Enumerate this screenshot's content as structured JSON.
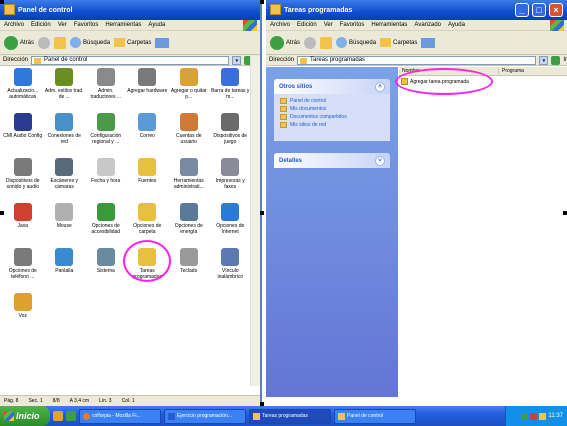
{
  "left_window": {
    "title": "Panel de control",
    "menu": [
      "Archivo",
      "Edición",
      "Ver",
      "Favoritos",
      "Herramientas",
      "Ayuda"
    ],
    "toolbar": {
      "back": "Atrás",
      "search": "Búsqueda",
      "folders": "Carpetas"
    },
    "address": {
      "label": "Dirección",
      "value": "Panel de control",
      "go": "Ir"
    },
    "items": [
      {
        "label": "Actualizacio... automáticas",
        "icon": "windows-update-icon",
        "color": "#2e7ad8"
      },
      {
        "label": "Adm. estilos trad. de ...",
        "icon": "admin-styles-icon",
        "color": "#6b8e23"
      },
      {
        "label": "Admin. traductores ...",
        "icon": "translator-admin-icon",
        "color": "#8a8a8a"
      },
      {
        "label": "Agregar hardware",
        "icon": "add-hardware-icon",
        "color": "#7a7a7a"
      },
      {
        "label": "Agregar o quitar p...",
        "icon": "add-remove-programs-icon",
        "color": "#d9a13b"
      },
      {
        "label": "Barra de tareas y m...",
        "icon": "taskbar-start-icon",
        "color": "#3a6fd8"
      },
      {
        "label": "CMI Audio Config",
        "icon": "audio-config-icon",
        "color": "#2a3c8f"
      },
      {
        "label": "Conexiones de red",
        "icon": "network-connections-icon",
        "color": "#4a90c8"
      },
      {
        "label": "Configuración regional y ...",
        "icon": "regional-settings-icon",
        "color": "#4a9a4a"
      },
      {
        "label": "Correo",
        "icon": "mail-icon",
        "color": "#5a9ad6"
      },
      {
        "label": "Cuentas de usuario",
        "icon": "user-accounts-icon",
        "color": "#d07a3a"
      },
      {
        "label": "Dispositivos de juego",
        "icon": "game-controllers-icon",
        "color": "#6a6a6a"
      },
      {
        "label": "Dispositivos de sonido y audio",
        "icon": "sound-devices-icon",
        "color": "#7a7a7a"
      },
      {
        "label": "Escáneres y cámaras",
        "icon": "scanners-cameras-icon",
        "color": "#5a6a7a"
      },
      {
        "label": "Fecha y hora",
        "icon": "date-time-icon",
        "color": "#c8c8c8"
      },
      {
        "label": "Fuentes",
        "icon": "fonts-icon",
        "color": "#e8c040"
      },
      {
        "label": "Herramientas administrati...",
        "icon": "admin-tools-icon",
        "color": "#7a8aa0"
      },
      {
        "label": "Impresoras y faxes",
        "icon": "printers-faxes-icon",
        "color": "#8a8a9a"
      },
      {
        "label": "Java",
        "icon": "java-icon",
        "color": "#d04030"
      },
      {
        "label": "Mouse",
        "icon": "mouse-icon",
        "color": "#b0b0b0"
      },
      {
        "label": "Opciones de accesibilidad",
        "icon": "accessibility-icon",
        "color": "#3a9a3a"
      },
      {
        "label": "Opciones de carpeta",
        "icon": "folder-options-icon",
        "color": "#e8c040"
      },
      {
        "label": "Opciones de energía",
        "icon": "power-options-icon",
        "color": "#5a7a9a"
      },
      {
        "label": "Opciones de Internet",
        "icon": "internet-options-icon",
        "color": "#2a7ad8"
      },
      {
        "label": "Opciones de teléfono ...",
        "icon": "phone-options-icon",
        "color": "#7a7a7a"
      },
      {
        "label": "Pantalla",
        "icon": "display-icon",
        "color": "#3a8ad0"
      },
      {
        "label": "Sistema",
        "icon": "system-icon",
        "color": "#6a8aa0"
      },
      {
        "label": "Tareas programadas",
        "icon": "scheduled-tasks-icon",
        "color": "#e8c040"
      },
      {
        "label": "Teclado",
        "icon": "keyboard-icon",
        "color": "#9a9a9a"
      },
      {
        "label": "Vínculo inalámbrico",
        "icon": "wireless-link-icon",
        "color": "#5a7ab0"
      },
      {
        "label": "Voz",
        "icon": "speech-icon",
        "color": "#e0a030"
      }
    ],
    "status": [
      "Pág. 8",
      "Sec. 1",
      "8/8",
      "A 3,4 cm",
      "Lín. 3",
      "Col. 1"
    ]
  },
  "right_window": {
    "title": "Tareas programadas",
    "menu": [
      "Archivo",
      "Edición",
      "Ver",
      "Favoritos",
      "Herramientas",
      "Avanzado",
      "Ayuda"
    ],
    "toolbar": {
      "back": "Atrás",
      "search": "Búsqueda",
      "folders": "Carpetas"
    },
    "address": {
      "label": "Dirección",
      "value": "Tareas programadas",
      "go": "Ir"
    },
    "other_sites": {
      "title": "Otros sitios",
      "links": [
        "Panel de control",
        "Mis documentos",
        "Documentos compartidos",
        "Mis sitios de red"
      ]
    },
    "details": {
      "title": "Detalles"
    },
    "columns": [
      "Nombre",
      "Programa"
    ],
    "files": [
      {
        "name": "Agregar tarea programada"
      }
    ]
  },
  "taskbar": {
    "start": "Inicio",
    "tasks": [
      "colforpia - Mozilla Fi...",
      "Ejercicio programación...",
      "Tareas programadas",
      "Panel de control"
    ],
    "clock": "11:37"
  },
  "colors": {
    "titlebar": "#0e4fd0",
    "highlight": "#ff22ee",
    "taskbar": "#245edb",
    "taskpane": "#6f8fe0"
  }
}
